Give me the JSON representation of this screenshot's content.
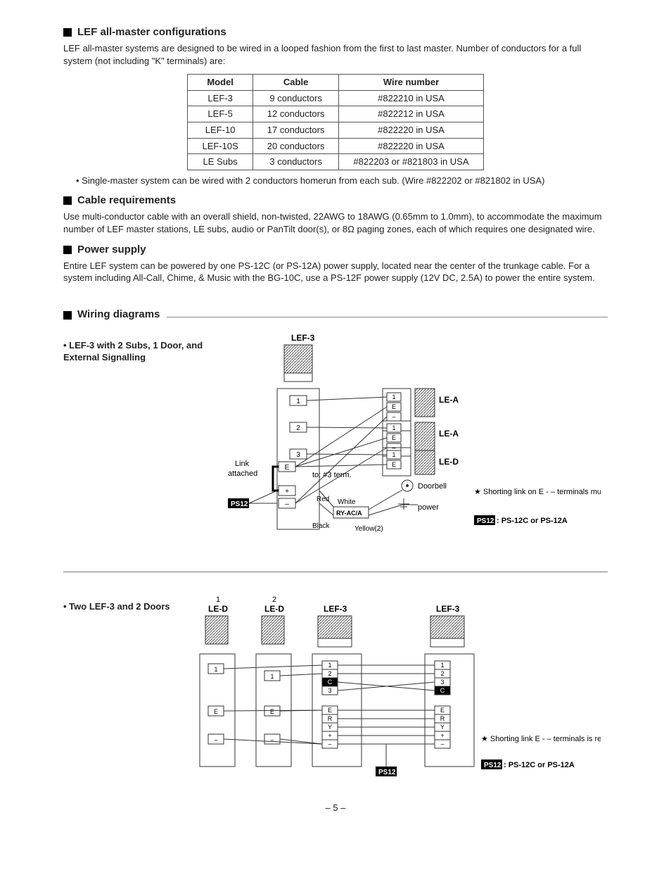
{
  "sec1": {
    "title": "LEF all-master configurations",
    "para": "LEF all-master systems are designed to be wired in a looped fashion from the first to last master. Number of conductors for a full system (not including \"K\" terminals) are:",
    "table": {
      "headers": [
        "Model",
        "Cable",
        "Wire number"
      ],
      "rows": [
        [
          "LEF-3",
          "9 conductors",
          "#822210 in USA"
        ],
        [
          "LEF-5",
          "12 conductors",
          "#822212 in USA"
        ],
        [
          "LEF-10",
          "17 conductors",
          "#822220 in USA"
        ],
        [
          "LEF-10S",
          "20 conductors",
          "#822220 in USA"
        ],
        [
          "LE Subs",
          "3 conductors",
          "#822203 or #821803 in USA"
        ]
      ]
    },
    "note": "Single-master system can be wired with 2 conductors homerun from each sub. (Wire #822202 or #821802 in USA)"
  },
  "sec2": {
    "title": "Cable requirements",
    "para": "Use multi-conductor cable with an overall shield, non-twisted, 22AWG to 18AWG (0.65mm to 1.0mm), to accommodate the maximum number of LEF master stations, LE subs, audio or PanTilt door(s), or 8Ω paging zones, each of which requires one designated wire."
  },
  "sec3": {
    "title": "Power supply",
    "para": "Entire LEF system can be powered by one PS-12C (or PS-12A) power supply, located near the center of the trunkage cable. For a system including All-Call, Chime, & Music with the BG-10C, use a PS-12F power supply (12V DC, 2.5A) to power the entire system."
  },
  "sec4": {
    "title": "Wiring diagrams"
  },
  "diag1": {
    "heading": "LEF-3 with 2 Subs, 1 Door, and External Signalling",
    "lef3": "LEF-3",
    "lea": "LE-A",
    "led": "LE-D",
    "link": "Link attached",
    "to3": "to: #3 term.",
    "doorbell": "Doorbell",
    "red": "Red",
    "white": "White",
    "black": "Black",
    "yellow2": "Yellow(2)",
    "ryaca": "RY-AC/A",
    "power": "power",
    "ps12": "PS12",
    "legend1": "★ Shorting link on E - – terminals must remain attached on all units.",
    "legend2_a": "PS12",
    "legend2_b": " : PS-12C or PS-12A",
    "t1": "1",
    "t2": "2",
    "t3": "3",
    "tE": "E",
    "tplus": "+",
    "tminus": "–"
  },
  "diag2": {
    "heading": "Two LEF-3 and 2 Doors",
    "col1_num": "1",
    "col2_num": "2",
    "led": "LE-D",
    "lef3": "LEF-3",
    "t1": "1",
    "t2": "2",
    "t3": "3",
    "tC": "C",
    "tE": "E",
    "tR": "R",
    "tY": "Y",
    "tplus": "+",
    "tminus": "–",
    "ps12": "PS12",
    "legend1": "★ Shorting link E - – terminals is removed on all units.",
    "legend2_a": "PS12",
    "legend2_b": " : PS-12C or PS-12A"
  },
  "page": "– 5 –"
}
